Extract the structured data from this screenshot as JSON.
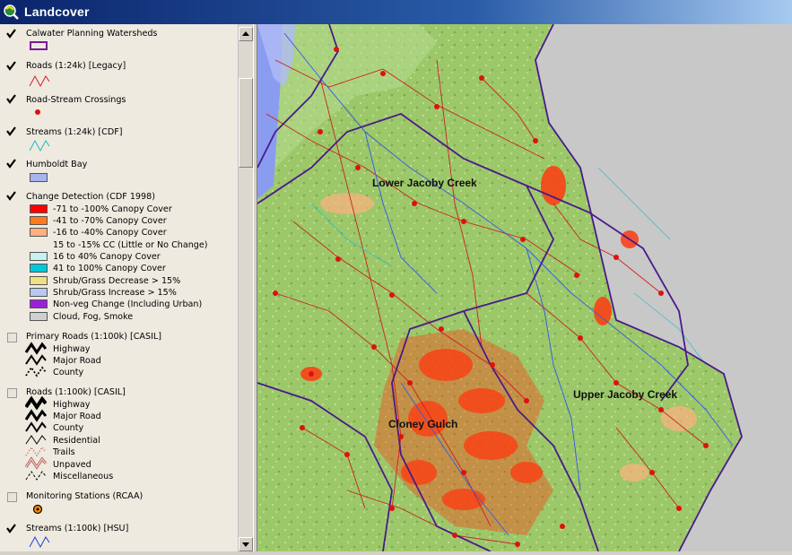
{
  "window": {
    "title": "Landcover"
  },
  "colors": {
    "titlebar": "#0a246a",
    "legend_bg": "#eeeae0",
    "map_bg": "#8ab85a",
    "change_high": "#ff2a00",
    "road_red": "#cc2020",
    "watershed_purple": "#5a1a8a"
  },
  "layers": [
    {
      "label": "Calwater Planning Watersheds",
      "checked": true,
      "icon": "purple-outline-box-icon"
    },
    {
      "label": "Roads (1:24k) [Legacy]",
      "checked": true,
      "icon": "red-line-icon"
    },
    {
      "label": "Road-Stream Crossings",
      "checked": true,
      "icon": "red-dot-icon"
    },
    {
      "label": "Streams (1:24k) [CDF]",
      "checked": true,
      "icon": "cyan-line-icon"
    },
    {
      "label": "Humboldt Bay",
      "checked": true,
      "icon": "blue-box-icon"
    },
    {
      "label": "Change Detection (CDF 1998)",
      "checked": true,
      "classes": [
        {
          "label": "-71 to -100% Canopy Cover",
          "color": "#ff0000"
        },
        {
          "label": "-41 to -70% Canopy Cover",
          "color": "#ff7a1a"
        },
        {
          "label": "-16 to -40% Canopy Cover",
          "color": "#ffb080"
        },
        {
          "label": "15 to -15% CC (Little or No Change)",
          "color": "none"
        },
        {
          "label": "16 to 40% Canopy Cover",
          "color": "#c8f0f0"
        },
        {
          "label": "41 to 100% Canopy Cover",
          "color": "#00c8d8"
        },
        {
          "label": "Shrub/Grass Decrease > 15%",
          "color": "#f0e080"
        },
        {
          "label": "Shrub/Grass Increase > 15%",
          "color": "#b8c8f0"
        },
        {
          "label": "Non-veg Change (Including Urban)",
          "color": "#9a20d8"
        },
        {
          "label": "Cloud, Fog, Smoke",
          "color": "#d0d0d0"
        }
      ]
    },
    {
      "label": "Primary Roads (1:100k) [CASIL]",
      "checked": false,
      "classes": [
        {
          "label": "Highway",
          "icon": "heavy-zigzag-icon"
        },
        {
          "label": "Major Road",
          "icon": "medium-zigzag-icon"
        },
        {
          "label": "County",
          "icon": "dashed-zigzag-icon"
        }
      ]
    },
    {
      "label": "Roads (1:100k) [CASIL]",
      "checked": false,
      "classes": [
        {
          "label": "Highway",
          "icon": "heavy-zigzag-icon"
        },
        {
          "label": "Major Road",
          "icon": "medium-zigzag-icon"
        },
        {
          "label": "County",
          "icon": "light-zigzag-icon"
        },
        {
          "label": "Residential",
          "icon": "thin-zigzag-icon"
        },
        {
          "label": "Trails",
          "icon": "dotted-red-zigzag-icon"
        },
        {
          "label": "Unpaved",
          "icon": "double-red-zigzag-icon"
        },
        {
          "label": "Miscellaneous",
          "icon": "dashed-thin-zigzag-icon"
        }
      ]
    },
    {
      "label": "Monitoring Stations (RCAA)",
      "checked": false,
      "icon": "station-marker-icon"
    },
    {
      "label": "Streams (1:100k) [HSU]",
      "checked": true,
      "icon": "blue-line-icon"
    }
  ],
  "map": {
    "labels": [
      "Lower Jacoby Creek",
      "Upper Jacoby Creek",
      "Cloney Gulch"
    ]
  }
}
